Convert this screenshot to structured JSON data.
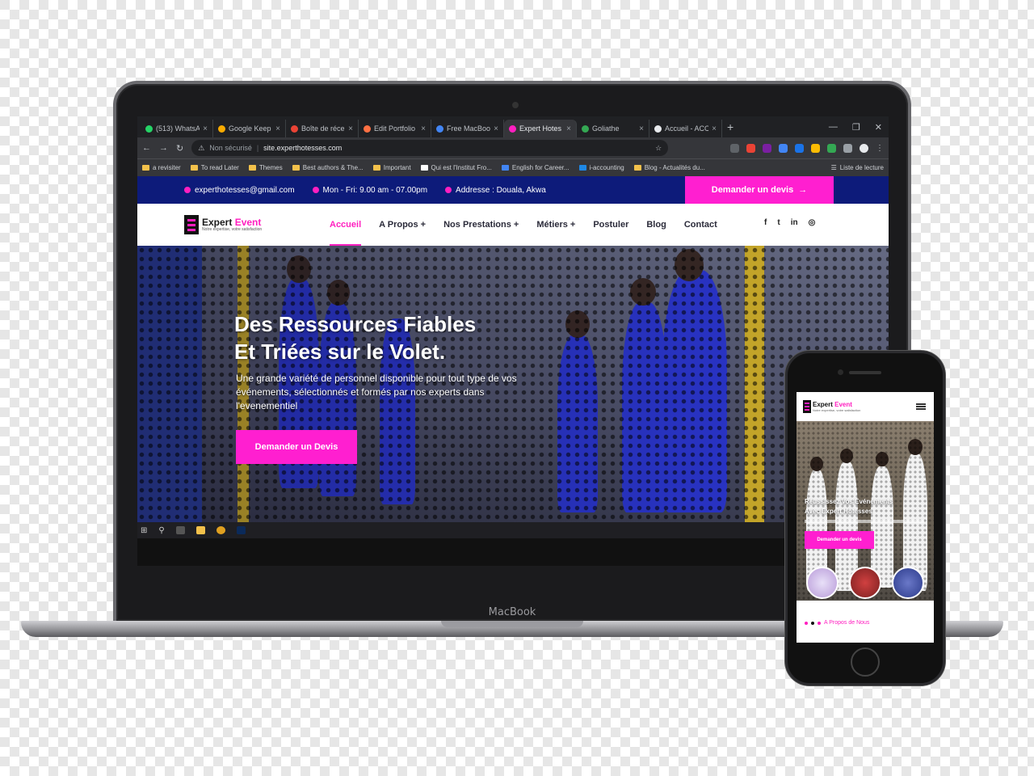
{
  "browser": {
    "tabs": [
      {
        "label": "(513) WhatsA",
        "color": "#25d366"
      },
      {
        "label": "Google Keep",
        "color": "#f9ab00"
      },
      {
        "label": "Boîte de réce",
        "color": "#ea4335"
      },
      {
        "label": "Edit Portfolio",
        "color": "#ff7043"
      },
      {
        "label": "Free MacBoo",
        "color": "#4285f4"
      },
      {
        "label": "Expert Hotes",
        "color": "#ff1fc0",
        "active": true
      },
      {
        "label": "Goliathe",
        "color": "#34a853"
      },
      {
        "label": "Accueil - ACC",
        "color": "#e8eaed"
      }
    ],
    "tab_close": "×",
    "new_tab": "+",
    "window_controls": [
      "—",
      "❐",
      "✕"
    ],
    "nav_icons": [
      "←",
      "→",
      "↻"
    ],
    "security": "Non sécurisé",
    "url": "site.experthotesses.com",
    "star_icon": "☆",
    "bookmarks": [
      "a revisiter",
      "To read Later",
      "Themes",
      "Best authors & The...",
      "Important",
      "Qui est l'Institut Fro...",
      "English for Career...",
      "i-accounting",
      "Blog - Actualités du..."
    ],
    "reading_list": "Liste de lecture"
  },
  "site": {
    "topbar": {
      "email": "experthotesses@gmail.com",
      "hours": "Mon - Fri: 9.00 am - 07.00pm",
      "address": "Addresse : Douala, Akwa",
      "cta": "Demander un devis",
      "cta_arrow": "→"
    },
    "logo": {
      "name_a": "Expert",
      "name_b": "Event",
      "tagline": "Notre expertise, votre satisfaction"
    },
    "menu": [
      "Accueil",
      "A Propos +",
      "Nos Prestations +",
      "Métiers +",
      "Postuler",
      "Blog",
      "Contact"
    ],
    "socials": [
      "f",
      "t",
      "in",
      "◎"
    ],
    "hero": {
      "title_line1": "Des Ressources Fiables",
      "title_line2": "Et Triées sur le Volet.",
      "subtitle": "Une grande variété de personnel disponible pour tout type de vos événements, sélectionnés et formés par nos experts dans l'evenementiel",
      "cta": "Demander un Devis"
    }
  },
  "laptop": {
    "brand": "MacBook"
  },
  "phone": {
    "logo": {
      "name_a": "Expert",
      "name_b": "Event",
      "tagline": "Notre expertise, votre satisfaction"
    },
    "hero": {
      "title_line1": "Réussissez Vos Evénements",
      "title_line2": "Avec Expert Hôtesses",
      "cta": "Demander un devis"
    },
    "about_link": "A Propos de Nous"
  },
  "colors": {
    "accent": "#ff1fd0",
    "topbar": "#0d1b7a"
  }
}
